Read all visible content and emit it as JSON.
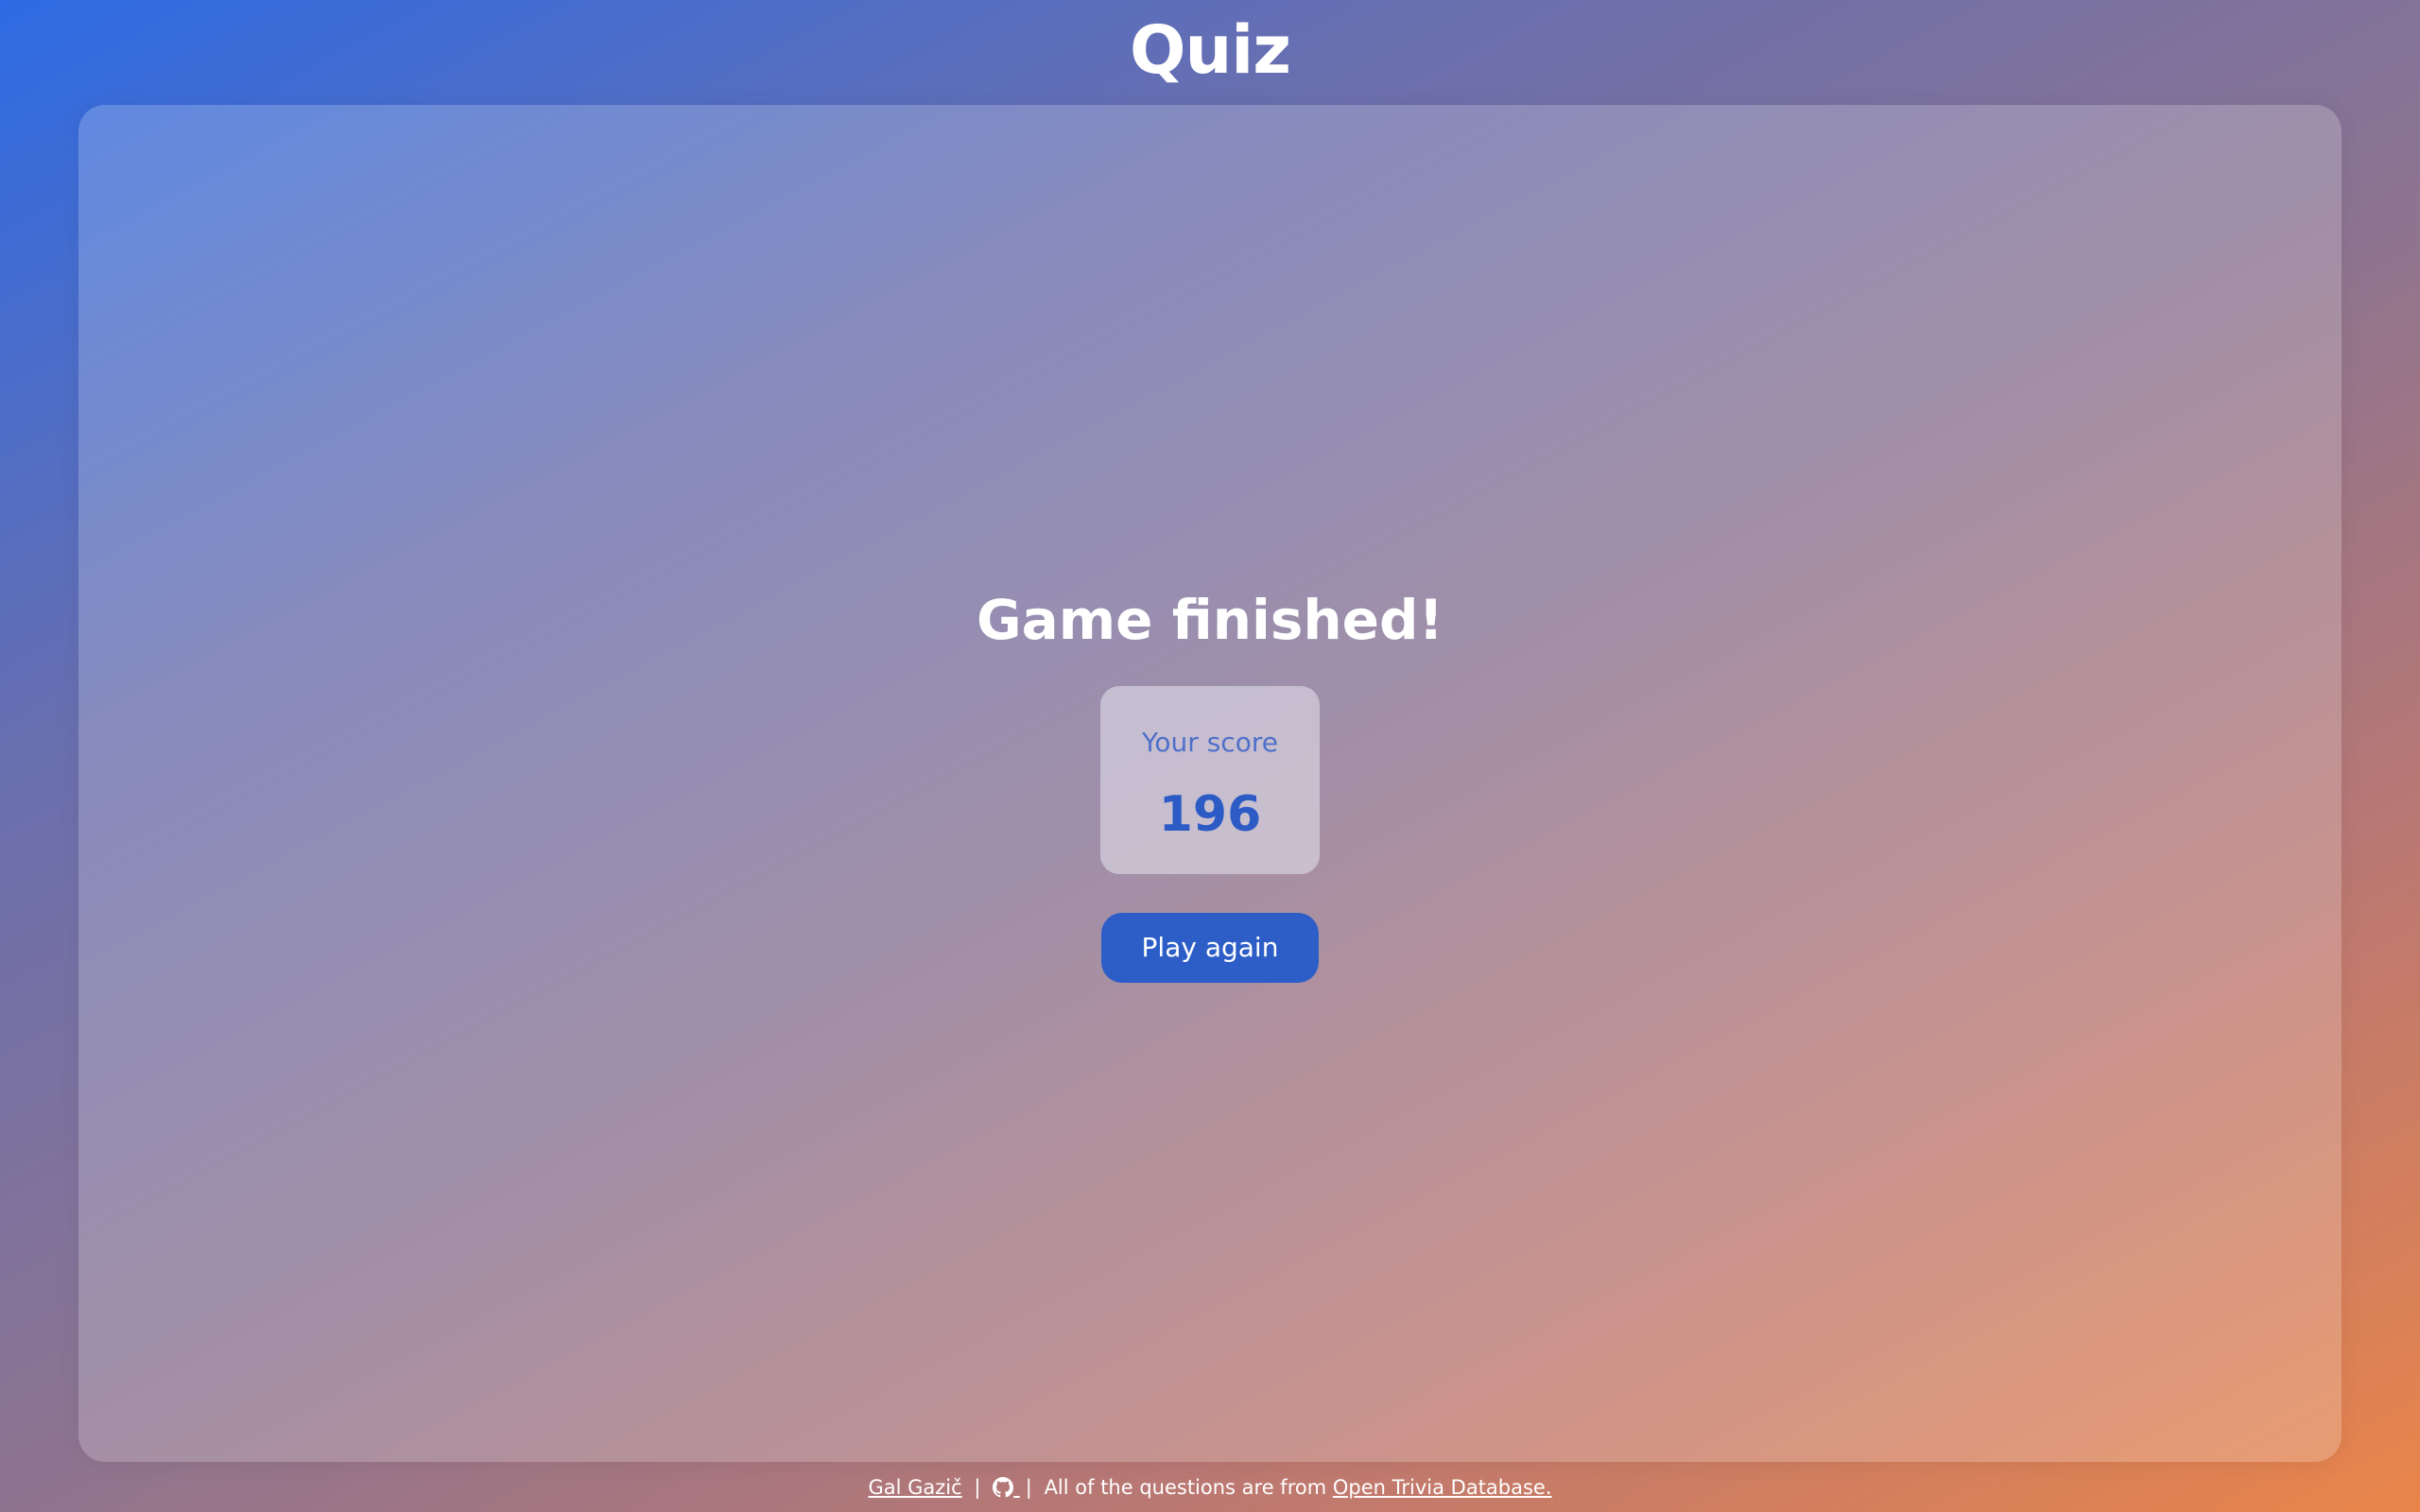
{
  "header": {
    "title": "Quiz"
  },
  "result": {
    "heading": "Game finished!",
    "score_label": "Your score",
    "score_value": "196",
    "play_again_label": "Play again"
  },
  "footer": {
    "author_link": "Gal Gazič",
    "separator": "|",
    "github_icon": "github-icon",
    "credit_text": "All of the questions are from",
    "source_link": "Open Trivia Database."
  },
  "colors": {
    "gradient_start": "#2d6be4",
    "gradient_end": "#e9854a",
    "accent": "#2d5ec7",
    "score_label": "#4f6fc9",
    "score_value": "#2d5bc5"
  }
}
